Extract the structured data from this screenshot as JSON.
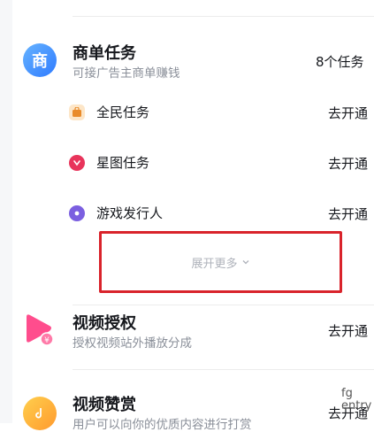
{
  "commerce_task": {
    "icon_text": "商",
    "title": "商单任务",
    "subtitle": "可接广告主商单赚钱",
    "count": "8个任务"
  },
  "sub_tasks": [
    {
      "label": "全民任务",
      "action": "去开通",
      "icon": "bag-icon",
      "color": "#f0a24b"
    },
    {
      "label": "星图任务",
      "action": "去开通",
      "icon": "star-map-icon",
      "color": "#e8345b"
    },
    {
      "label": "游戏发行人",
      "action": "去开通",
      "icon": "game-icon",
      "color": "#7b5fe0"
    }
  ],
  "expand": {
    "label": "展开更多"
  },
  "video_license": {
    "title": "视频授权",
    "subtitle": "授权视频站外播放分成",
    "action": "去开通"
  },
  "video_tip": {
    "title": "视频赞赏",
    "subtitle": "用户可以向你的优质内容进行打赏",
    "action": "去开通"
  },
  "broken_image": {
    "alt": "fg entry"
  },
  "colors": {
    "accent_red": "#d9232b",
    "commerce_blue": "#3c8cff",
    "license_pink": "#ff4d8d"
  }
}
